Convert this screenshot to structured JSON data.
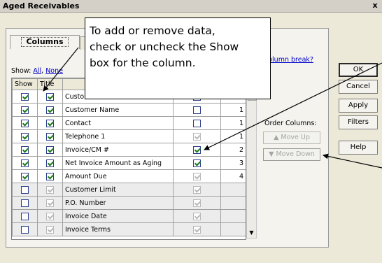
{
  "window": {
    "title": "Aged Receivables",
    "close_glyph": "x"
  },
  "tab": {
    "label": "Columns"
  },
  "show": {
    "label": "Show:",
    "all": "All",
    "sep": ",",
    "none": "None"
  },
  "column_break": "column break?",
  "table": {
    "headers": [
      "Show",
      "Title",
      "",
      "",
      ""
    ],
    "rows": [
      {
        "show": true,
        "title_on": true,
        "title_disabled": false,
        "name": "Customer ID",
        "brk": false,
        "brk_disabled": false,
        "order": ""
      },
      {
        "show": true,
        "title_on": true,
        "title_disabled": false,
        "name": "Customer Name",
        "brk": false,
        "brk_disabled": false,
        "order": "1"
      },
      {
        "show": true,
        "title_on": true,
        "title_disabled": false,
        "name": "Contact",
        "brk": false,
        "brk_disabled": false,
        "order": "1"
      },
      {
        "show": true,
        "title_on": true,
        "title_disabled": false,
        "name": "Telephone 1",
        "brk": true,
        "brk_disabled": true,
        "order": "1"
      },
      {
        "show": true,
        "title_on": true,
        "title_disabled": false,
        "name": "Invoice/CM #",
        "brk": true,
        "brk_disabled": false,
        "order": "2"
      },
      {
        "show": true,
        "title_on": true,
        "title_disabled": false,
        "name": "Net Invoice Amount as Aging",
        "brk": true,
        "brk_disabled": false,
        "order": "3"
      },
      {
        "show": true,
        "title_on": true,
        "title_disabled": false,
        "name": "Amount Due",
        "brk": true,
        "brk_disabled": true,
        "order": "4"
      },
      {
        "show": false,
        "title_on": true,
        "title_disabled": true,
        "name": "Customer Limit",
        "brk": true,
        "brk_disabled": true,
        "order": ""
      },
      {
        "show": false,
        "title_on": true,
        "title_disabled": true,
        "name": "P.O. Number",
        "brk": true,
        "brk_disabled": true,
        "order": ""
      },
      {
        "show": false,
        "title_on": true,
        "title_disabled": true,
        "name": "Invoice Date",
        "brk": true,
        "brk_disabled": true,
        "order": ""
      },
      {
        "show": false,
        "title_on": true,
        "title_disabled": true,
        "name": "Invoice Terms",
        "brk": true,
        "brk_disabled": true,
        "order": ""
      }
    ]
  },
  "order": {
    "label": "Order Columns:",
    "move_up": "Move Up",
    "move_down": "Move Down",
    "up_glyph": "▲",
    "down_glyph": "▼"
  },
  "buttons": {
    "ok": "OK",
    "cancel": "Cancel",
    "apply": "Apply",
    "filters": "Filters",
    "help": "Help"
  },
  "scroll": {
    "down_glyph": "▼"
  },
  "callout": {
    "line1": "To add or remove data,",
    "line2": "check or uncheck the Show",
    "line3": "box for the column."
  }
}
